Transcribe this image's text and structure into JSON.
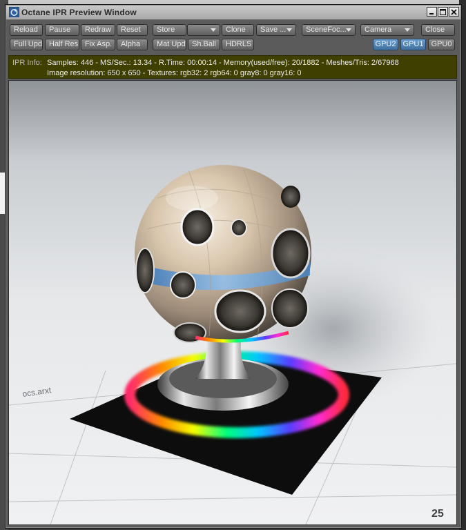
{
  "window": {
    "title": "Octane IPR Preview Window"
  },
  "toolbar": {
    "row1": {
      "reload": "Reload",
      "pause": "Pause",
      "redraw": "Redraw",
      "reset": "Reset",
      "store": "Store",
      "store_slot": "",
      "clone": "Clone",
      "save": "Save ...",
      "scene_focus": "SceneFoc...",
      "camera": "Camera",
      "close": "Close"
    },
    "row2": {
      "full_upd": "Full Upd.",
      "half_res": "Half Res",
      "fix_asp": "Fix Asp.",
      "alpha": "Alpha",
      "mat_upd": "Mat Upd",
      "sh_ball": "Sh.Ball",
      "hdrls": "HDRLS",
      "gpus": [
        "GPU2",
        "GPU1",
        "GPU0"
      ],
      "gpu_active": [
        true,
        true,
        false
      ]
    }
  },
  "info": {
    "label": "IPR Info:",
    "line1": "Samples: 446  -  MS/Sec.: 13.34  -  R.Time: 00:00:14 - Memory(used/free): 20/1882  -  Meshes/Tris: 2/67968",
    "line2": "Image resolution: 650 x 650 - Textures:  rgb32: 2   rgb64: 0   gray8: 0   gray16: 0"
  },
  "render": {
    "floor_text_left": "ocs.arxt",
    "floor_text_right": "25"
  },
  "colors": {
    "info_bg": "#3f3f00",
    "gpu_active": "#4f82b3"
  }
}
